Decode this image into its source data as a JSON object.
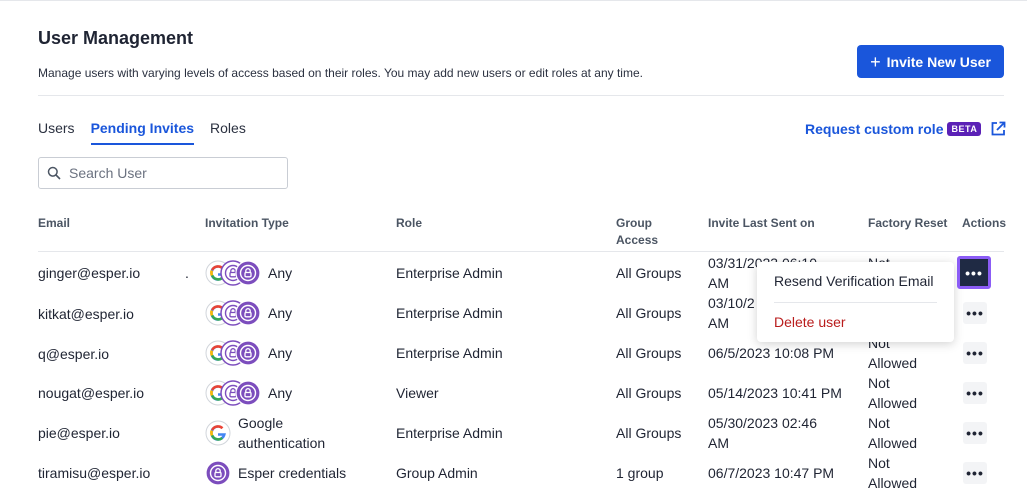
{
  "header": {
    "title": "User Management",
    "subtitle": "Manage users with varying levels of access based on their roles. You may add new users or edit roles at any time.",
    "invite_label": "Invite New User"
  },
  "tabs": [
    {
      "label": "Users",
      "active": false
    },
    {
      "label": "Pending Invites",
      "active": true
    },
    {
      "label": "Roles",
      "active": false
    }
  ],
  "request": {
    "label": "Request custom role",
    "badge": "BETA"
  },
  "search": {
    "placeholder": "Search User"
  },
  "columns": {
    "email": "Email",
    "invitation_type": "Invitation Type",
    "role": "Role",
    "group_access_1": "Group",
    "group_access_2": "Access",
    "invite_last_sent": "Invite Last Sent on",
    "factory_reset": "Factory Reset",
    "actions": "Actions"
  },
  "rows": [
    {
      "email": "ginger@esper.io",
      "type": "Any",
      "role": "Enterprise Admin",
      "group": "All Groups",
      "sent1": "03/31/2023 06:10",
      "sent2": "AM",
      "reset1": "Not",
      "reset2": ""
    },
    {
      "email": "kitkat@esper.io",
      "type": "Any",
      "role": "Enterprise Admin",
      "group": "All Groups",
      "sent1": "03/10/2",
      "sent2": "AM",
      "reset1": "",
      "reset2": ""
    },
    {
      "email": "q@esper.io",
      "type": "Any",
      "role": "Enterprise Admin",
      "group": "All Groups",
      "sent1": "06/5/2023 10:08 PM",
      "sent2": "",
      "reset1": "Not",
      "reset2": "Allowed"
    },
    {
      "email": "nougat@esper.io",
      "type": "Any",
      "role": "Viewer",
      "group": "All Groups",
      "sent1": "05/14/2023 10:41 PM",
      "sent2": "",
      "reset1": "Not",
      "reset2": "Allowed"
    },
    {
      "email": "pie@esper.io",
      "type1": "Google",
      "type2": "authentication",
      "role": "Enterprise Admin",
      "group": "All Groups",
      "sent1": "05/30/2023 02:46",
      "sent2": "AM",
      "reset1": "Not",
      "reset2": "Allowed"
    },
    {
      "email": "tiramisu@esper.io",
      "type": "Esper credentials",
      "role": "Group Admin",
      "group": "1 group",
      "sent1": "06/7/2023 10:47 PM",
      "sent2": "",
      "reset1": "Not",
      "reset2": "Allowed"
    }
  ],
  "stray_mark": ".",
  "actions_label": "•••",
  "context_menu": {
    "resend": "Resend Verification Email",
    "delete": "Delete user"
  },
  "colors": {
    "primary": "#1a56db",
    "beta_badge": "#5b21b6",
    "esper_purple": "#7c4dbd",
    "danger": "#b91c1c",
    "focus_ring": "#8b5cf6"
  },
  "icons": {
    "search": "search-icon",
    "external": "external-link-icon",
    "google": "google-icon",
    "esper": "esper-lock-icon",
    "more": "more-horizontal-icon"
  }
}
